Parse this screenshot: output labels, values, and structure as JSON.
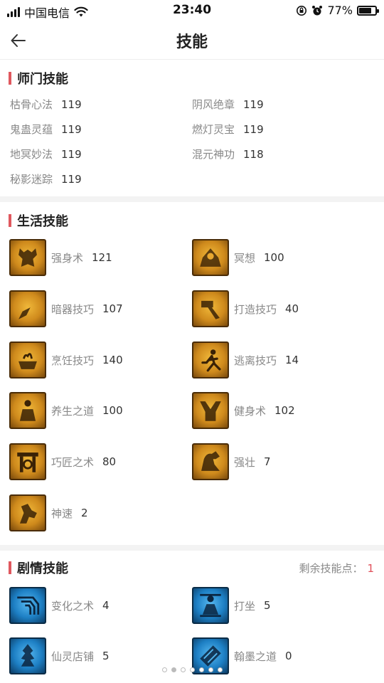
{
  "status": {
    "carrier": "中国电信",
    "time": "23:40",
    "battery": "77%",
    "battery_level": 0.77
  },
  "nav": {
    "title": "技能"
  },
  "sect_skills": {
    "title": "师门技能",
    "items": [
      {
        "name": "枯骨心法",
        "level": "119"
      },
      {
        "name": "阴风绝章",
        "level": "119"
      },
      {
        "name": "鬼蛊灵蕴",
        "level": "119"
      },
      {
        "name": "燃灯灵宝",
        "level": "119"
      },
      {
        "name": "地冥妙法",
        "level": "119"
      },
      {
        "name": "混元神功",
        "level": "118"
      },
      {
        "name": "秘影迷踪",
        "level": "119"
      }
    ]
  },
  "life_skills": {
    "title": "生活技能",
    "items": [
      {
        "name": "强身术",
        "level": "121",
        "icon": "body-strength-icon"
      },
      {
        "name": "冥想",
        "level": "100",
        "icon": "meditation-icon"
      },
      {
        "name": "暗器技巧",
        "level": "107",
        "icon": "dart-icon"
      },
      {
        "name": "打造技巧",
        "level": "40",
        "icon": "hammer-icon"
      },
      {
        "name": "烹饪技巧",
        "level": "140",
        "icon": "cooking-icon"
      },
      {
        "name": "逃离技巧",
        "level": "14",
        "icon": "escape-icon"
      },
      {
        "name": "养生之道",
        "level": "100",
        "icon": "health-icon"
      },
      {
        "name": "健身术",
        "level": "102",
        "icon": "fitness-icon"
      },
      {
        "name": "巧匠之术",
        "level": "80",
        "icon": "craftsman-icon"
      },
      {
        "name": "强壮",
        "level": "7",
        "icon": "muscle-icon"
      },
      {
        "name": "神速",
        "level": "2",
        "icon": "speed-icon"
      }
    ]
  },
  "story_skills": {
    "title": "剧情技能",
    "remaining_label": "剩余技能点：",
    "remaining_value": "1",
    "items": [
      {
        "name": "变化之术",
        "level": "4",
        "icon": "transform-icon"
      },
      {
        "name": "打坐",
        "level": "5",
        "icon": "sitting-icon"
      },
      {
        "name": "仙灵店铺",
        "level": "5",
        "icon": "shop-icon"
      },
      {
        "name": "翰墨之道",
        "level": "0",
        "icon": "calligraphy-icon"
      }
    ]
  },
  "pagination": {
    "count": 7,
    "active_index": 1
  }
}
